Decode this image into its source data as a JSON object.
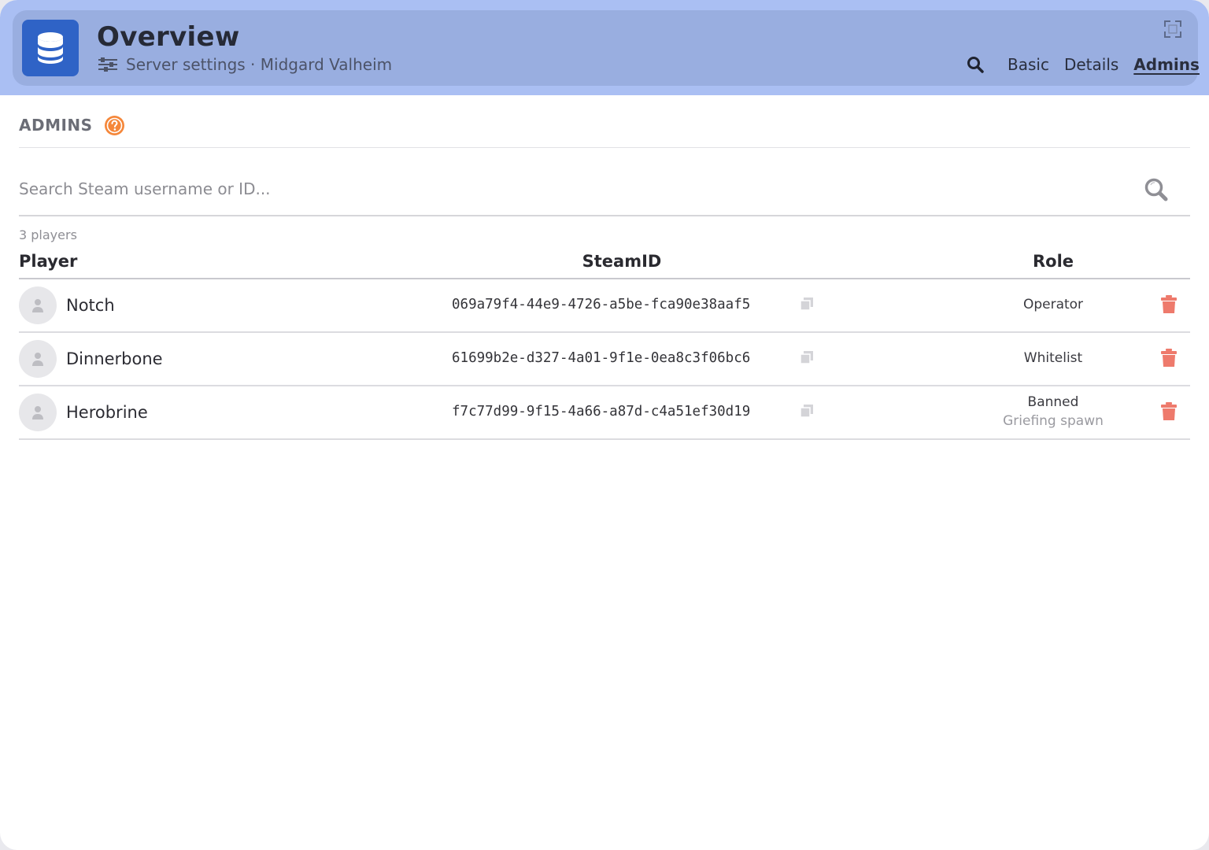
{
  "header": {
    "title": "Overview",
    "subtitle": "Server settings · Midgard Valheim",
    "tabs": [
      {
        "label": "Basic",
        "active": false
      },
      {
        "label": "Details",
        "active": false
      },
      {
        "label": "Admins",
        "active": true
      }
    ]
  },
  "section": {
    "title": "ADMINS"
  },
  "search": {
    "placeholder": "Search Steam username or ID...",
    "value": ""
  },
  "table": {
    "count_label": "3 players",
    "columns": [
      "Player",
      "SteamID",
      "Role"
    ],
    "rows": [
      {
        "name": "Notch",
        "steamid": "069a79f4-44e9-4726-a5be-fca90e38aaf5",
        "role": "Operator",
        "note": ""
      },
      {
        "name": "Dinnerbone",
        "steamid": "61699b2e-d327-4a01-9f1e-0ea8c3f06bc6",
        "role": "Whitelist",
        "note": ""
      },
      {
        "name": "Herobrine",
        "steamid": "f7c77d99-9f15-4a66-a87d-c4a51ef30d19",
        "role": "Banned",
        "note": "Griefing spawn"
      }
    ]
  },
  "colors": {
    "header_band": "#aabff3",
    "header_card": "#99aee0",
    "app_icon": "#2f63c6",
    "help_icon": "#f5873a",
    "trash_icon": "#ee7a6c"
  },
  "icons": {
    "app": "database-icon",
    "subtitle": "sliders-icon",
    "expand": "fullscreen-icon",
    "nav_search": "search-icon",
    "help": "question-icon",
    "search_button": "search-icon",
    "avatar": "user-icon",
    "copy": "copy-icon",
    "delete": "trash-icon"
  }
}
